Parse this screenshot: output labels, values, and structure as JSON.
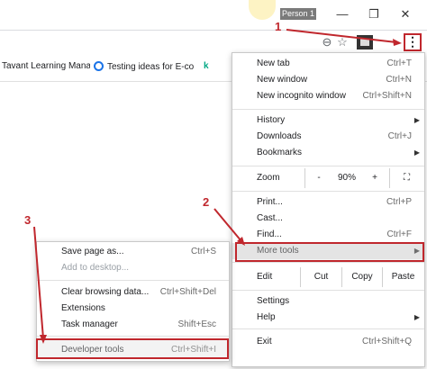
{
  "profile": {
    "name": "Person 1"
  },
  "window_controls": {
    "minimize": "—",
    "maximize": "❐",
    "close": "✕"
  },
  "toolbar_icons": {
    "zoom": "⊖",
    "star": "☆",
    "more": "⋮"
  },
  "bookmarks": [
    {
      "label": "Tavant Learning Mana"
    },
    {
      "label": "Testing ideas for E-co"
    },
    {
      "label": "k"
    }
  ],
  "menu": {
    "new_tab": {
      "label": "New tab",
      "shortcut": "Ctrl+T"
    },
    "new_window": {
      "label": "New window",
      "shortcut": "Ctrl+N"
    },
    "new_incognito": {
      "label": "New incognito window",
      "shortcut": "Ctrl+Shift+N"
    },
    "history": {
      "label": "History"
    },
    "downloads": {
      "label": "Downloads",
      "shortcut": "Ctrl+J"
    },
    "bookmarks": {
      "label": "Bookmarks"
    },
    "zoom": {
      "label": "Zoom",
      "minus": "-",
      "value": "90%",
      "plus": "+",
      "fullscreen": "⛶"
    },
    "print": {
      "label": "Print...",
      "shortcut": "Ctrl+P"
    },
    "cast": {
      "label": "Cast..."
    },
    "find": {
      "label": "Find...",
      "shortcut": "Ctrl+F"
    },
    "more_tools": {
      "label": "More tools"
    },
    "edit": {
      "label": "Edit",
      "cut": "Cut",
      "copy": "Copy",
      "paste": "Paste"
    },
    "settings": {
      "label": "Settings"
    },
    "help": {
      "label": "Help"
    },
    "exit": {
      "label": "Exit",
      "shortcut": "Ctrl+Shift+Q"
    }
  },
  "submenu": {
    "save_page": {
      "label": "Save page as...",
      "shortcut": "Ctrl+S"
    },
    "add_desktop": {
      "label": "Add to desktop..."
    },
    "clear_data": {
      "label": "Clear browsing data...",
      "shortcut": "Ctrl+Shift+Del"
    },
    "extensions": {
      "label": "Extensions"
    },
    "task_manager": {
      "label": "Task manager",
      "shortcut": "Shift+Esc"
    },
    "dev_tools": {
      "label": "Developer tools",
      "shortcut": "Ctrl+Shift+I"
    }
  },
  "annotations": {
    "step1": "1",
    "step2": "2",
    "step3": "3",
    "color": "#c0272d"
  }
}
